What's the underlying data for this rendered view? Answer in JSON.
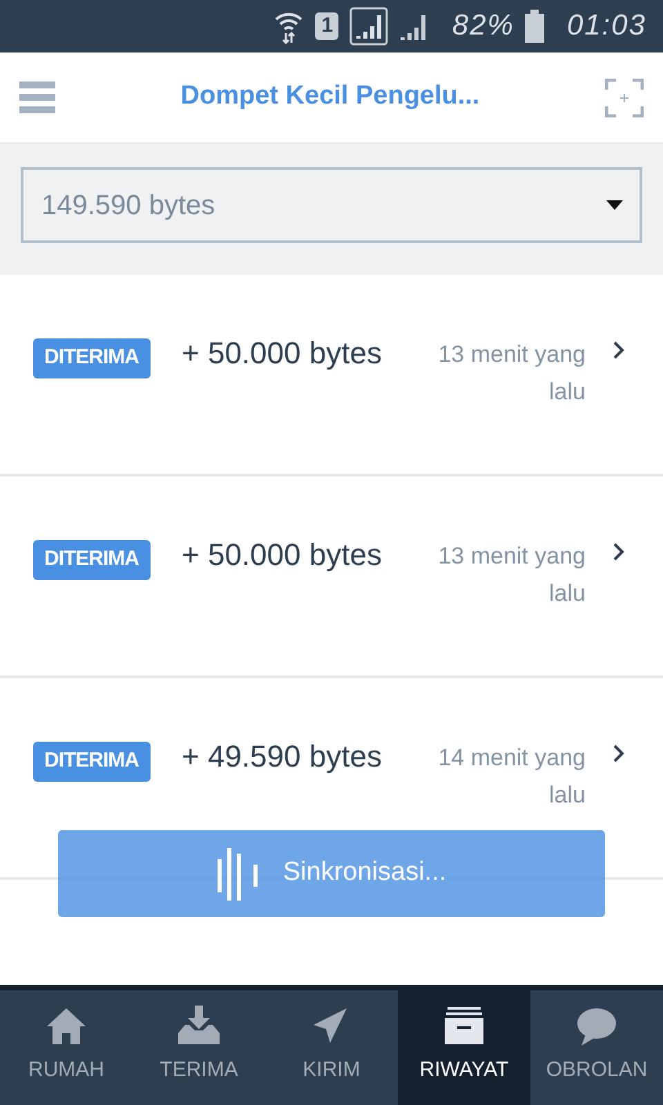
{
  "status_bar": {
    "sim_slot": "1",
    "battery": "82%",
    "time": "01:03"
  },
  "header": {
    "title": "Dompet Kecil Pengelu..."
  },
  "wallet_select": {
    "value": "149.590 bytes"
  },
  "transactions": [
    {
      "status": "DITERIMA",
      "amount": "+ 50.000 bytes",
      "time": "13 menit yang lalu"
    },
    {
      "status": "DITERIMA",
      "amount": "+ 50.000 bytes",
      "time": "13 menit yang lalu"
    },
    {
      "status": "DITERIMA",
      "amount": "+ 49.590 bytes",
      "time": "14 menit yang lalu"
    }
  ],
  "toast": {
    "text": "Sinkronisasi..."
  },
  "tabs": [
    {
      "kind": "home",
      "label": "RUMAH",
      "selected": false
    },
    {
      "kind": "receive",
      "label": "TERIMA",
      "selected": false
    },
    {
      "kind": "send",
      "label": "KIRIM",
      "selected": false
    },
    {
      "kind": "history",
      "label": "RIWAYAT",
      "selected": true
    },
    {
      "kind": "chat",
      "label": "OBROLAN",
      "selected": false
    }
  ]
}
